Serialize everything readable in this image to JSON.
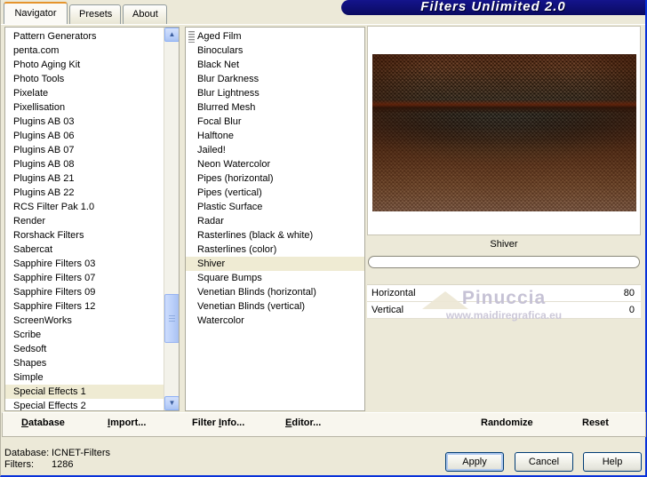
{
  "window": {
    "title": "Filters Unlimited 2.0"
  },
  "tabs": {
    "navigator": "Navigator",
    "presets": "Presets",
    "about": "About"
  },
  "left_list": {
    "items": [
      "Pattern Generators",
      "penta.com",
      "Photo Aging Kit",
      "Photo Tools",
      "Pixelate",
      "Pixellisation",
      "Plugins AB 03",
      "Plugins AB 06",
      "Plugins AB 07",
      "Plugins AB 08",
      "Plugins AB 21",
      "Plugins AB 22",
      "RCS Filter Pak 1.0",
      "Render",
      "Rorshack Filters",
      "Sabercat",
      "Sapphire Filters 03",
      "Sapphire Filters 07",
      "Sapphire Filters 09",
      "Sapphire Filters 12",
      "ScreenWorks",
      "Scribe",
      "Sedsoft",
      "Shapes",
      "Simple",
      "Special Effects 1",
      "Special Effects 2"
    ],
    "selected": "Special Effects 1"
  },
  "filter_list": {
    "items": [
      "Aged Film",
      "Binoculars",
      "Black Net",
      "Blur Darkness",
      "Blur Lightness",
      "Blurred Mesh",
      "Focal Blur",
      "Halftone",
      "Jailed!",
      "Neon Watercolor",
      "Pipes (horizontal)",
      "Pipes (vertical)",
      "Plastic Surface",
      "Radar",
      "Rasterlines (black & white)",
      "Rasterlines (color)",
      "Shiver",
      "Square Bumps",
      "Venetian Blinds (horizontal)",
      "Venetian Blinds (vertical)",
      "Watercolor"
    ],
    "selected": "Shiver"
  },
  "preview": {
    "filter_name": "Shiver"
  },
  "params": [
    {
      "name": "Horizontal",
      "value": "80"
    },
    {
      "name": "Vertical",
      "value": "0"
    }
  ],
  "watermark": {
    "line1": "Pinuccia",
    "line2": "www.maidiregrafica.eu"
  },
  "toolbar": {
    "database": {
      "pre": "",
      "key": "D",
      "post": "atabase"
    },
    "import": {
      "pre": "",
      "key": "I",
      "post": "mport..."
    },
    "filter_info": {
      "pre": "Filter ",
      "key": "I",
      "post": "nfo..."
    },
    "editor": {
      "pre": "",
      "key": "E",
      "post": "ditor..."
    },
    "randomize": "Randomize",
    "reset": "Reset"
  },
  "status": {
    "database_label": "Database:",
    "database_value": "ICNET-Filters",
    "filters_label": "Filters:",
    "filters_value": "1286"
  },
  "buttons": {
    "apply": "Apply",
    "cancel": "Cancel",
    "help": "Help"
  },
  "colors": {
    "banner_navy": "#0E0E78",
    "selection_bg": "#EFEBD3",
    "dialog_beige": "#ECE9D8",
    "xp_frame_blue": "#0831D9"
  }
}
